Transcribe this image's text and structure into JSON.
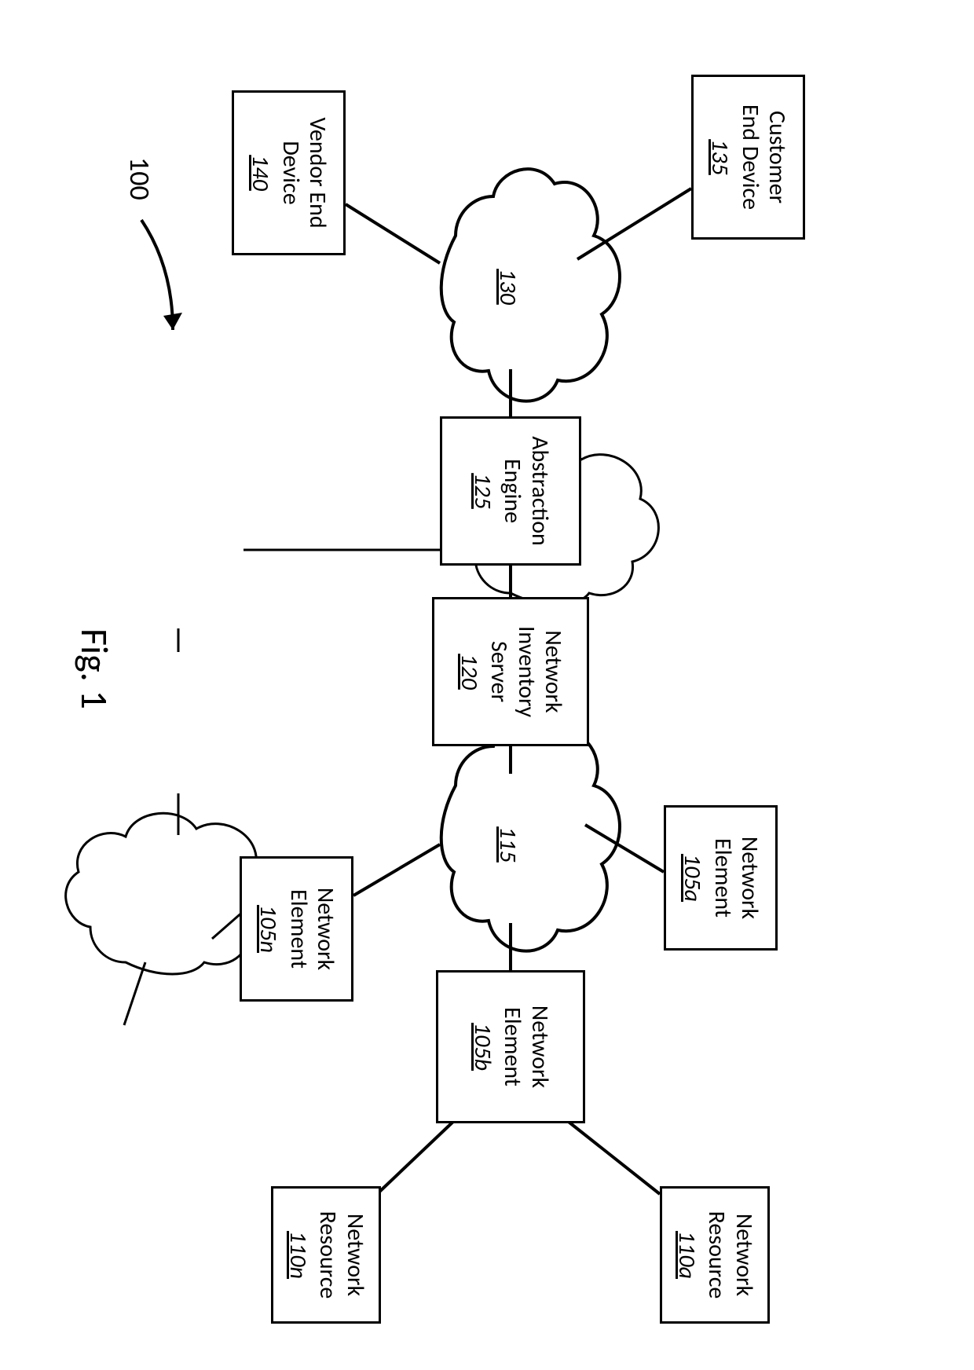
{
  "figure_label": "Fig. 1",
  "system_ref": "100",
  "clouds": {
    "left": {
      "ref": "130"
    },
    "right": {
      "ref": "115"
    }
  },
  "boxes": {
    "customer_end_device": {
      "lines": [
        "Customer",
        "End Device"
      ],
      "ref": "135"
    },
    "vendor_end_device": {
      "lines": [
        "Vendor End",
        "Device"
      ],
      "ref": "140"
    },
    "abstraction_engine": {
      "lines": [
        "Abstraction",
        "Engine"
      ],
      "ref": "125"
    },
    "network_inventory_server": {
      "lines": [
        "Network",
        "Inventory",
        "Server"
      ],
      "ref": "120"
    },
    "network_element_105a": {
      "lines": [
        "Network",
        "Element"
      ],
      "ref": "105a"
    },
    "network_element_105b": {
      "lines": [
        "Network",
        "Element"
      ],
      "ref": "105b"
    },
    "network_element_105n": {
      "lines": [
        "Network",
        "Element"
      ],
      "ref": "105n"
    },
    "network_resource_110a": {
      "lines": [
        "Network",
        "Resource"
      ],
      "ref": "110a"
    },
    "network_resource_110n": {
      "lines": [
        "Network",
        "Resource"
      ],
      "ref": "110n"
    }
  }
}
